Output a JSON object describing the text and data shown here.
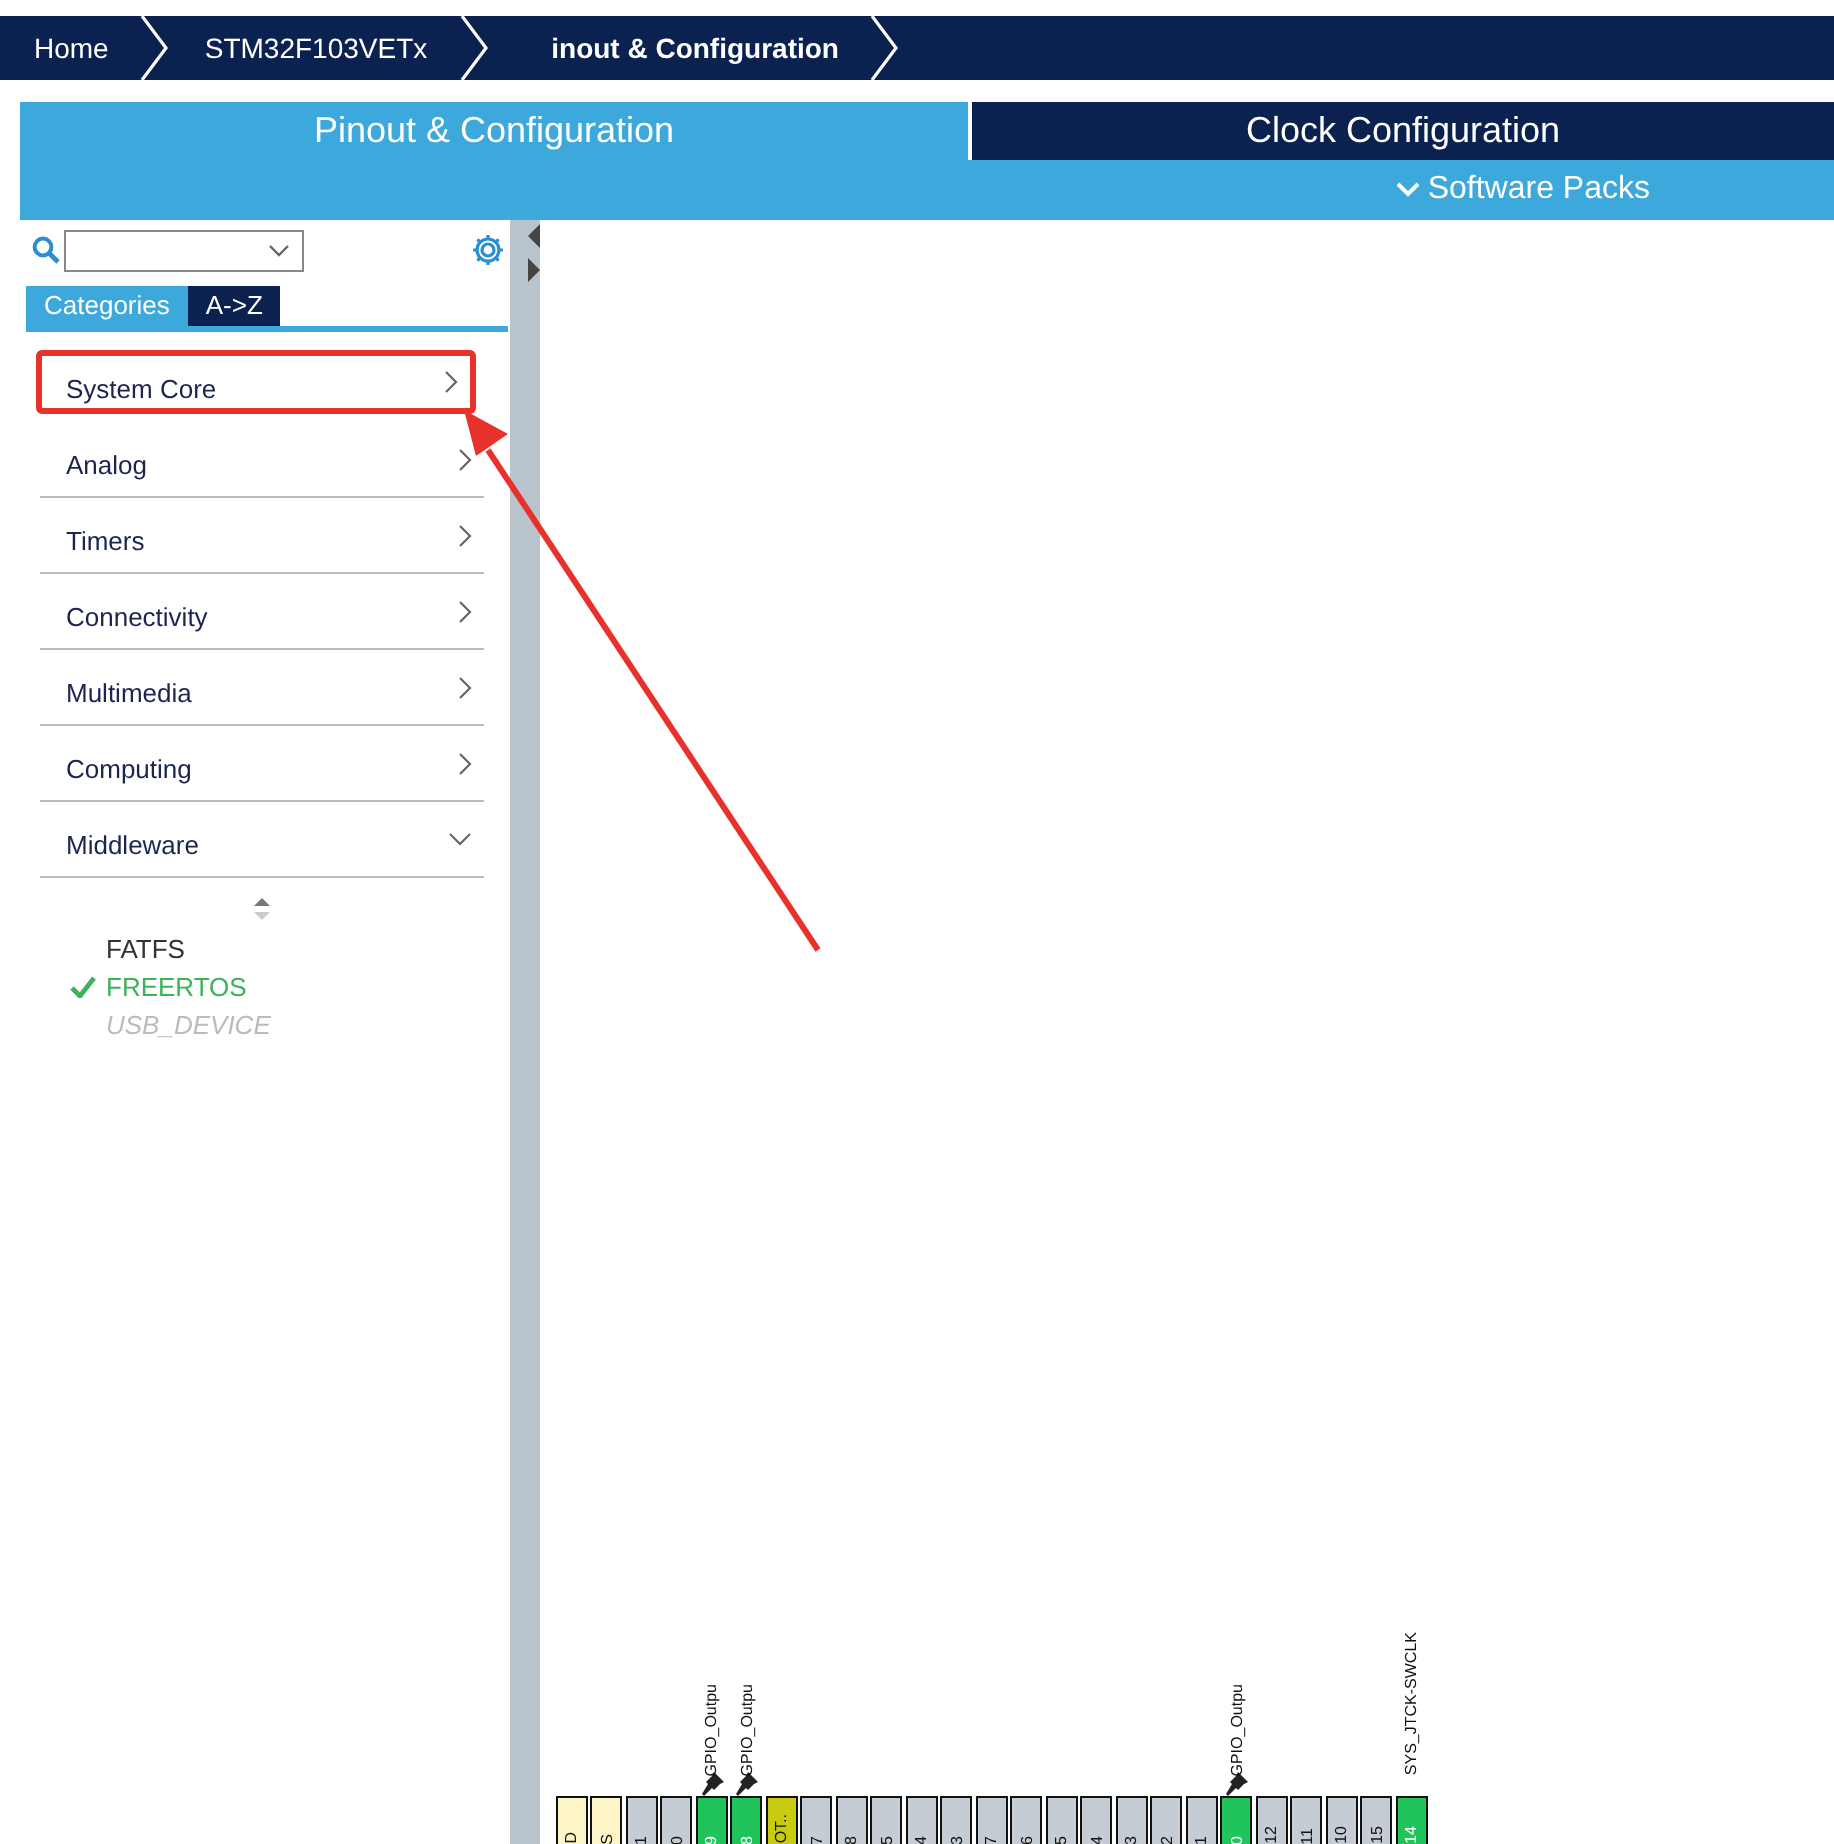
{
  "breadcrumb": [
    {
      "label": "Home"
    },
    {
      "label": "STM32F103VETx"
    },
    {
      "label": "inout & Configuration"
    }
  ],
  "tabs": [
    {
      "label": "Pinout & Configuration",
      "selected": true
    },
    {
      "label": "Clock Configuration",
      "selected": false
    }
  ],
  "software_packs": {
    "label": "Software Packs"
  },
  "sidebar": {
    "tabs": [
      {
        "label": "Categories",
        "selected": true
      },
      {
        "label": "A->Z",
        "selected": false
      }
    ],
    "categories": [
      {
        "label": "System Core",
        "expanded": false,
        "highlighted": true
      },
      {
        "label": "Analog",
        "expanded": false,
        "highlighted": false
      },
      {
        "label": "Timers",
        "expanded": false,
        "highlighted": false
      },
      {
        "label": "Connectivity",
        "expanded": false,
        "highlighted": false
      },
      {
        "label": "Multimedia",
        "expanded": false,
        "highlighted": false
      },
      {
        "label": "Computing",
        "expanded": false,
        "highlighted": false
      },
      {
        "label": "Middleware",
        "expanded": true,
        "highlighted": false,
        "children": [
          {
            "label": "FATFS",
            "checked": false,
            "disabled": false
          },
          {
            "label": "FREERTOS",
            "checked": true,
            "disabled": false
          },
          {
            "label": "USB_DEVICE",
            "checked": false,
            "disabled": true
          }
        ]
      }
    ]
  },
  "pins": [
    {
      "label": "D",
      "kind": "power"
    },
    {
      "label": "S",
      "kind": "power"
    },
    {
      "label": "1",
      "kind": "io"
    },
    {
      "label": "0",
      "kind": "io"
    },
    {
      "label": "9",
      "kind": "gpio",
      "signal": "GPIO_Outpu",
      "pinned": true
    },
    {
      "label": "8",
      "kind": "gpio",
      "signal": "GPIO_Outpu",
      "pinned": true
    },
    {
      "label": "OT..",
      "kind": "special"
    },
    {
      "label": "7",
      "kind": "io"
    },
    {
      "label": "8",
      "kind": "io"
    },
    {
      "label": "5",
      "kind": "io"
    },
    {
      "label": "4",
      "kind": "io"
    },
    {
      "label": "3",
      "kind": "io"
    },
    {
      "label": "7",
      "kind": "io"
    },
    {
      "label": "6",
      "kind": "io"
    },
    {
      "label": "5",
      "kind": "io"
    },
    {
      "label": "4",
      "kind": "io"
    },
    {
      "label": "3",
      "kind": "io"
    },
    {
      "label": "2",
      "kind": "io"
    },
    {
      "label": "1",
      "kind": "io"
    },
    {
      "label": "0",
      "kind": "gpio",
      "signal": "GPIO_Outpu",
      "pinned": true
    },
    {
      "label": "12",
      "kind": "io"
    },
    {
      "label": "11",
      "kind": "io"
    },
    {
      "label": "10",
      "kind": "io"
    },
    {
      "label": "15",
      "kind": "io"
    },
    {
      "label": "14",
      "kind": "gpio",
      "signal": "SYS_JTCK-SWCLK",
      "pinned": false
    }
  ]
}
